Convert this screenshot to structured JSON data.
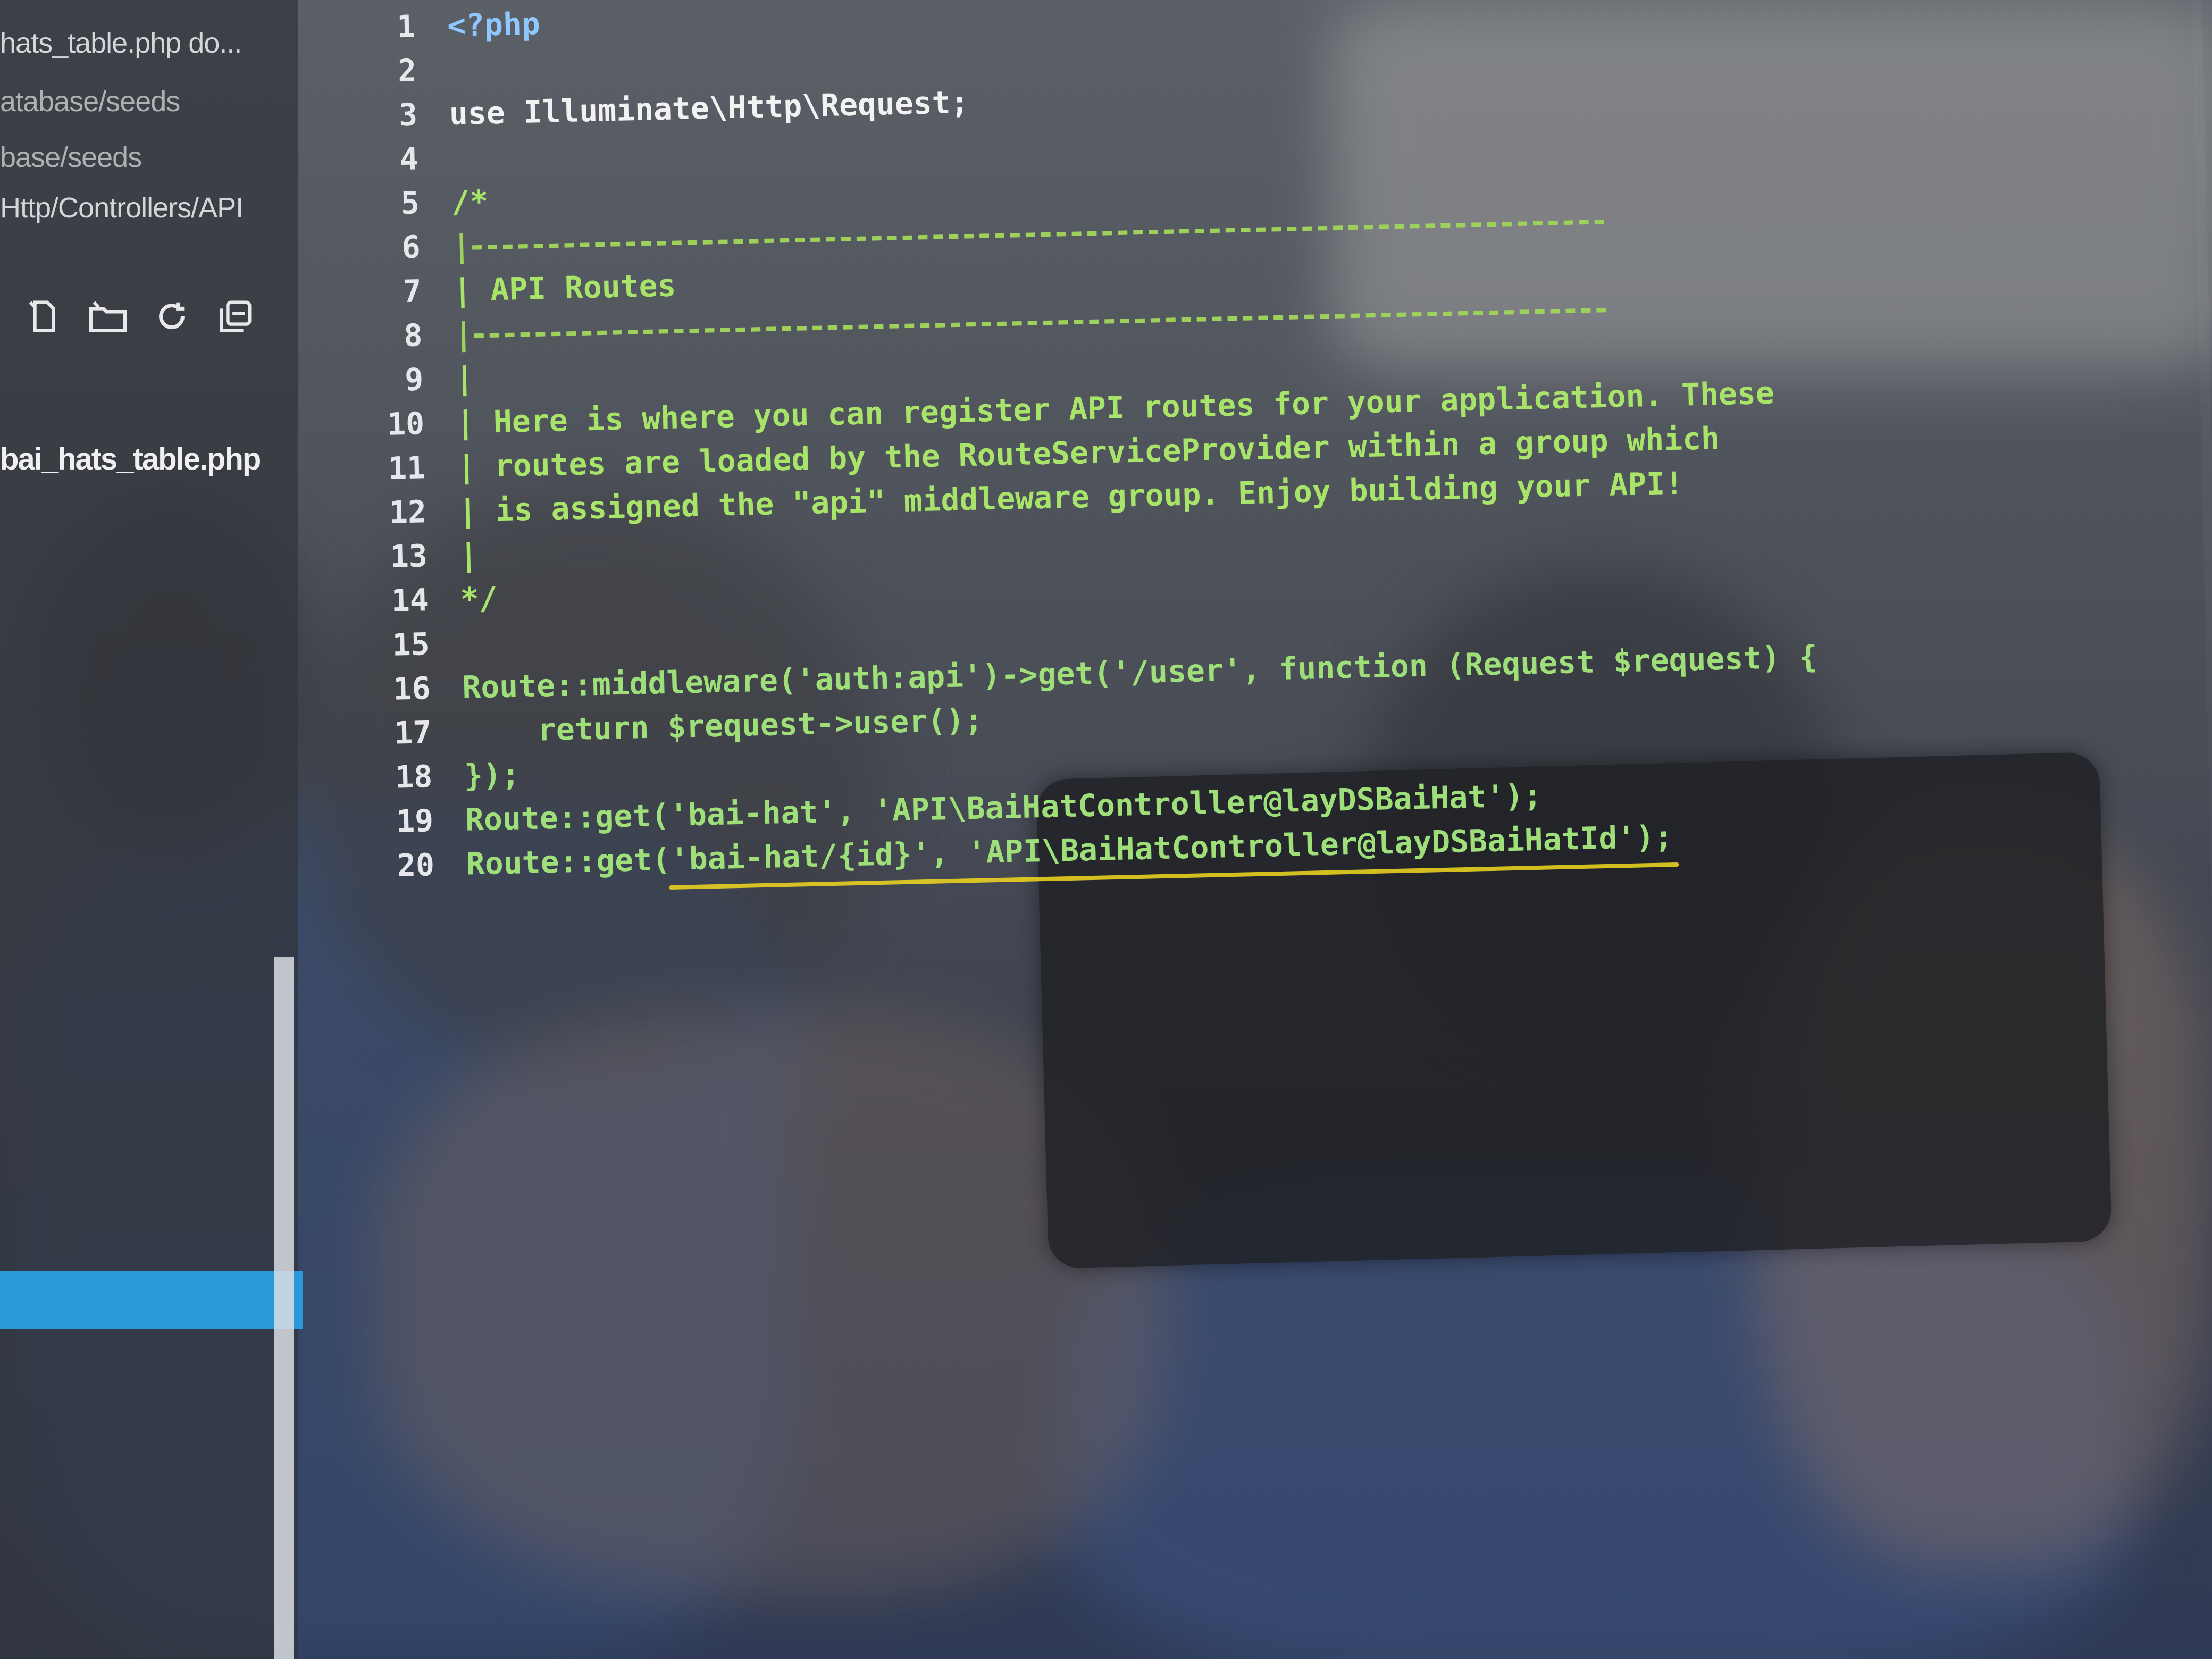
{
  "sidebar": {
    "paths": [
      "hats_table.php  do...",
      "atabase/seeds",
      "base/seeds",
      "Http/Controllers/API"
    ],
    "active_file": "bai_hats_table.php",
    "toolbar_icons": [
      "new-file-icon",
      "new-folder-icon",
      "refresh-icon",
      "collapse-all-icon"
    ]
  },
  "editor": {
    "language": "PHP",
    "line_numbers": [
      "1",
      "2",
      "3",
      "4",
      "5",
      "6",
      "7",
      "8",
      "9",
      "10",
      "11",
      "12",
      "13",
      "14",
      "15",
      "16",
      "17",
      "18",
      "19",
      "20"
    ],
    "lines": [
      "<?php",
      "",
      "use Illuminate\\Http\\Request;",
      "",
      "/*",
      "|--------------------------------------------------------------------------",
      "| API Routes",
      "|--------------------------------------------------------------------------",
      "|",
      "| Here is where you can register API routes for your application. These",
      "| routes are loaded by the RouteServiceProvider within a group which",
      "| is assigned the \"api\" middleware group. Enjoy building your API!",
      "|",
      "*/",
      "",
      "Route::middleware('auth:api')->get('/user', function (Request $request) {",
      "    return $request->user();",
      "});",
      "Route::get('bai-hat', 'API\\BaiHatController@layDSBaiHat');",
      "Route::get('bai-hat/{id}', 'API\\BaiHatController@layDSBaiHatId');"
    ]
  },
  "colors": {
    "comment": "#a8e36a",
    "keyword": "#8fc7ff",
    "string": "#f0e070",
    "selection": "#2aa3e8",
    "underline": "#e8d020"
  }
}
